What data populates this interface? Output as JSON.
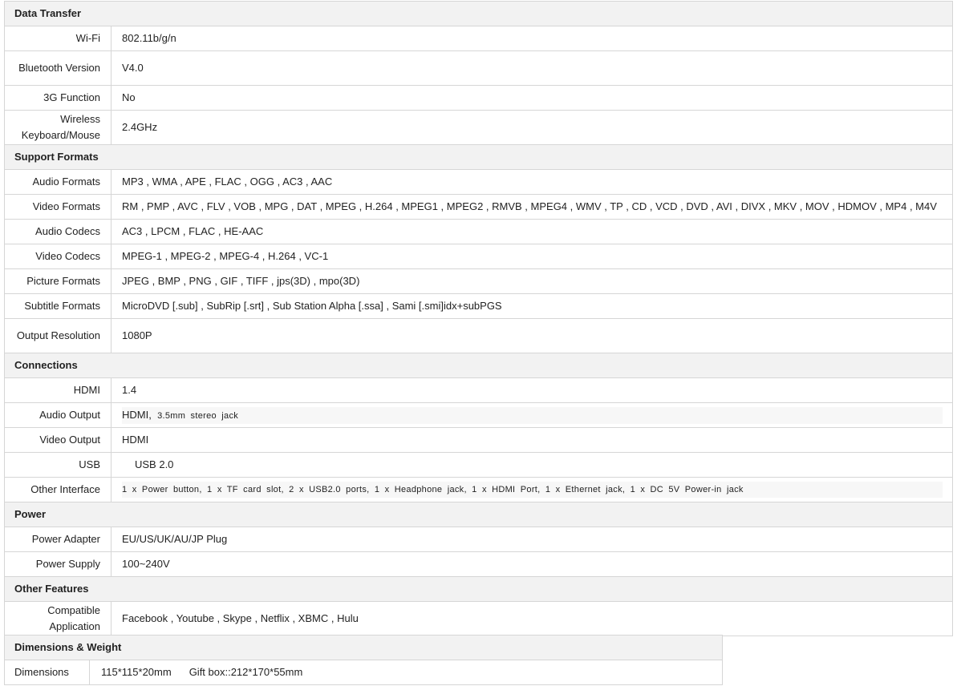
{
  "sections": [
    {
      "title": "Data Transfer",
      "rows": [
        {
          "label": "Wi-Fi",
          "value": "802.11b/g/n"
        },
        {
          "label": "Bluetooth Version",
          "value": "V4.0"
        },
        {
          "label": "3G Function",
          "value": "No"
        },
        {
          "label": "Wireless Keyboard/Mouse",
          "value": "2.4GHz"
        }
      ]
    },
    {
      "title": "Support Formats",
      "rows": [
        {
          "label": "Audio Formats",
          "value": "MP3 , WMA , APE , FLAC , OGG , AC3 , AAC"
        },
        {
          "label": "Video Formats",
          "value": "RM , PMP , AVC , FLV , VOB , MPG , DAT , MPEG , H.264 , MPEG1 , MPEG2 , RMVB , MPEG4 , WMV , TP , CD , VCD , DVD , AVI , DIVX , MKV , MOV , HDMOV , MP4 , M4V"
        },
        {
          "label": "Audio Codecs",
          "value": "AC3 , LPCM , FLAC , HE-AAC"
        },
        {
          "label": "Video Codecs",
          "value": "MPEG-1 , MPEG-2 , MPEG-4 , H.264 , VC-1"
        },
        {
          "label": "Picture Formats",
          "value": "JPEG , BMP , PNG , GIF , TIFF , jps(3D) , mpo(3D)"
        },
        {
          "label": "Subtitle Formats",
          "value": "MicroDVD [.sub] , SubRip [.srt] , Sub Station Alpha [.ssa] , Sami [.smi]idx+subPGS"
        },
        {
          "label": "Output Resolution",
          "value": "1080P"
        }
      ]
    },
    {
      "title": "Connections",
      "rows": [
        {
          "label": "HDMI",
          "value": "1.4"
        },
        {
          "label": "Audio Output",
          "value_main": "HDMI,",
          "value_small": "3.5mm stereo jack"
        },
        {
          "label": "Video Output",
          "value": "HDMI"
        },
        {
          "label": "USB",
          "value": "USB 2.0"
        },
        {
          "label": "Other Interface",
          "value": "1 x Power button, 1 x TF card slot, 2 x USB2.0 ports, 1 x Headphone jack, 1 x HDMI Port, 1 x Ethernet jack, 1 x DC 5V Power-in jack"
        }
      ]
    },
    {
      "title": "Power",
      "rows": [
        {
          "label": "Power Adapter",
          "value": "EU/US/UK/AU/JP Plug"
        },
        {
          "label": "Power Supply",
          "value": "100~240V"
        }
      ]
    },
    {
      "title": "Other Features",
      "rows": [
        {
          "label": "Compatible Application",
          "value": "Facebook , Youtube , Skype , Netflix , XBMC , Hulu"
        }
      ]
    }
  ],
  "dimensions_weight": {
    "title": "Dimensions & Weight",
    "label": "Dimensions",
    "size": "115*115*20mm",
    "gift_box": "Gift box::212*170*55mm"
  }
}
